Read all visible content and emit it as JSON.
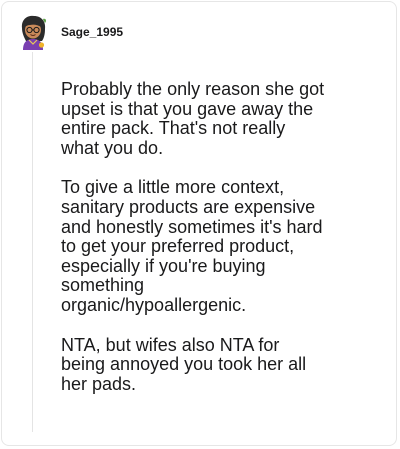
{
  "comment": {
    "author": "Sage_1995",
    "avatar_icon": "user-avatar-icon",
    "paragraphs": [
      "Probably the only reason she got\nupset is that you gave away the\nentire pack. That's not really\nwhat you do.",
      "To give a little more context,\nsanitary products are expensive\nand honestly sometimes it's hard\nto get your preferred product,\nespecially if you're buying\nsomething\norganic/hypoallergenic.",
      "NTA, but wifes also NTA for\nbeing annoyed you took her all\nher pads."
    ]
  }
}
